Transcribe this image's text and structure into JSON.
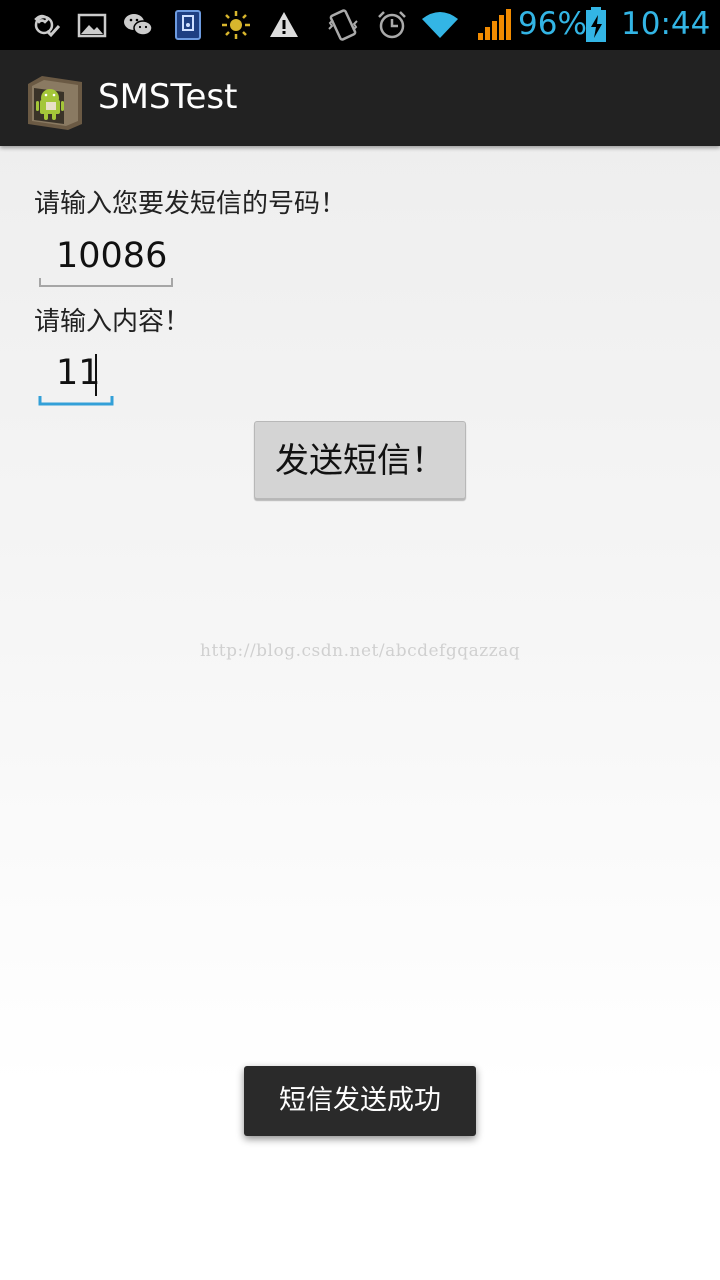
{
  "status_bar": {
    "battery_percent": "96%",
    "time": "10:44",
    "icons": [
      "missed-call-icon",
      "gallery-icon",
      "wechat-icon",
      "sim-icon",
      "brightness-icon",
      "warning-icon",
      "vibrate-icon",
      "alarm-icon",
      "wifi-icon",
      "signal-icon",
      "battery-charging-icon"
    ],
    "accent_color": "#33b5e5"
  },
  "action_bar": {
    "title": "SMSTest",
    "icon": "android-app-icon"
  },
  "form": {
    "phone_label": "请输入您要发短信的号码！",
    "phone_value": "10086",
    "content_label": "请输入内容！",
    "content_value": "11",
    "send_button_label": "发送短信！"
  },
  "watermark": "http://blog.csdn.net/abcdefgqazzaq",
  "toast": "短信发送成功"
}
